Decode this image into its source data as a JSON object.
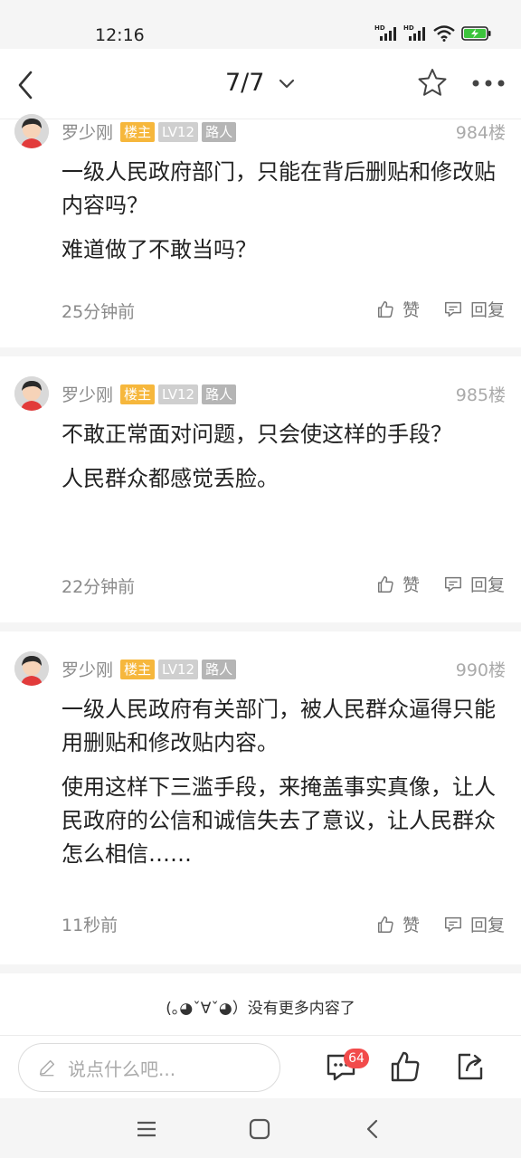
{
  "status_bar": {
    "time": "12:16",
    "icons": [
      "hd-signal-icon",
      "hd-signal-icon",
      "wifi-icon",
      "battery-charging-icon"
    ],
    "battery_color": "#3cc43c"
  },
  "nav": {
    "title": "7/7",
    "icons": [
      "back-icon",
      "chevron-down-icon",
      "star-icon",
      "more-icon"
    ]
  },
  "posts": [
    {
      "author": "罗少刚",
      "badge_host": "楼主",
      "badge_level": "LV12",
      "badge_title": "路人",
      "floor": "984楼",
      "paragraphs": [
        "一级人民政府部门，只能在背后删贴和修改贴内容吗？",
        "难道做了不敢当吗？"
      ],
      "time": "25分钟前",
      "like_label": "赞",
      "reply_label": "回复"
    },
    {
      "author": "罗少刚",
      "badge_host": "楼主",
      "badge_level": "LV12",
      "badge_title": "路人",
      "floor": "985楼",
      "paragraphs": [
        "不敢正常面对问题，只会使这样的手段？",
        "人民群众都感觉丢脸。"
      ],
      "time": "22分钟前",
      "like_label": "赞",
      "reply_label": "回复"
    },
    {
      "author": "罗少刚",
      "badge_host": "楼主",
      "badge_level": "LV12",
      "badge_title": "路人",
      "floor": "990楼",
      "paragraphs": [
        "一级人民政府有关部门，被人民群众逼得只能用删贴和修改贴内容。",
        "使用这样下三滥手段，来掩盖事实真像，让人民政府的公信和诚信失去了意议，让人民群众怎么相信……"
      ],
      "time": "11秒前",
      "like_label": "赞",
      "reply_label": "回复"
    }
  ],
  "no_more": "(｡◕ˇ∀ˇ◕）没有更多内容了",
  "bottom_bar": {
    "reply_placeholder": "说点什么吧...",
    "comment_count": "64",
    "icons": [
      "pencil-icon",
      "comment-icon",
      "thumbs-up-icon",
      "share-icon"
    ],
    "badge_color": "#f24b4b"
  },
  "system_nav": {
    "icons": [
      "menu-icon",
      "home-icon",
      "back-icon"
    ]
  }
}
